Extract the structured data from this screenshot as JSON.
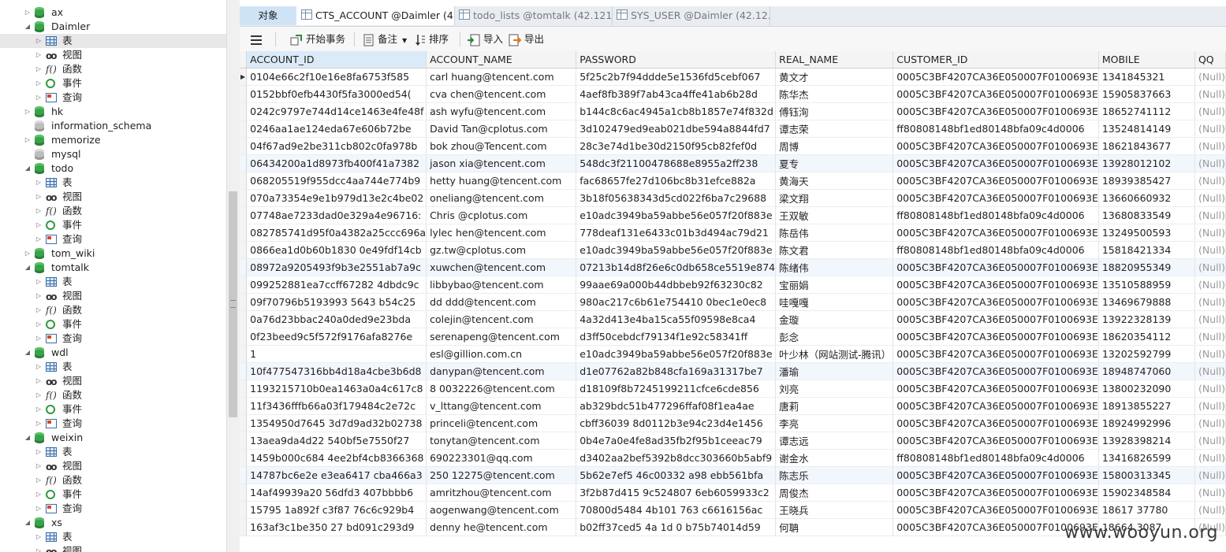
{
  "tree": [
    {
      "label": "ax",
      "level": 0,
      "type": "db",
      "expanded": false
    },
    {
      "label": "Daimler",
      "level": 0,
      "type": "db",
      "expanded": true
    },
    {
      "label": "表",
      "level": 1,
      "type": "table",
      "selected": true
    },
    {
      "label": "视图",
      "level": 1,
      "type": "view"
    },
    {
      "label": "函数",
      "level": 1,
      "type": "func"
    },
    {
      "label": "事件",
      "level": 1,
      "type": "event"
    },
    {
      "label": "查询",
      "level": 1,
      "type": "query"
    },
    {
      "label": "hk",
      "level": 0,
      "type": "db",
      "expanded": false
    },
    {
      "label": "information_schema",
      "level": 0,
      "type": "db-gray",
      "expanded": null
    },
    {
      "label": "memorize",
      "level": 0,
      "type": "db",
      "expanded": false
    },
    {
      "label": "mysql",
      "level": 0,
      "type": "db-gray",
      "expanded": null
    },
    {
      "label": "todo",
      "level": 0,
      "type": "db",
      "expanded": true
    },
    {
      "label": "表",
      "level": 1,
      "type": "table"
    },
    {
      "label": "视图",
      "level": 1,
      "type": "view"
    },
    {
      "label": "函数",
      "level": 1,
      "type": "func"
    },
    {
      "label": "事件",
      "level": 1,
      "type": "event"
    },
    {
      "label": "查询",
      "level": 1,
      "type": "query"
    },
    {
      "label": "tom_wiki",
      "level": 0,
      "type": "db",
      "expanded": false
    },
    {
      "label": "tomtalk",
      "level": 0,
      "type": "db",
      "expanded": true
    },
    {
      "label": "表",
      "level": 1,
      "type": "table"
    },
    {
      "label": "视图",
      "level": 1,
      "type": "view"
    },
    {
      "label": "函数",
      "level": 1,
      "type": "func"
    },
    {
      "label": "事件",
      "level": 1,
      "type": "event"
    },
    {
      "label": "查询",
      "level": 1,
      "type": "query"
    },
    {
      "label": "wdl",
      "level": 0,
      "type": "db",
      "expanded": true
    },
    {
      "label": "表",
      "level": 1,
      "type": "table"
    },
    {
      "label": "视图",
      "level": 1,
      "type": "view"
    },
    {
      "label": "函数",
      "level": 1,
      "type": "func"
    },
    {
      "label": "事件",
      "level": 1,
      "type": "event"
    },
    {
      "label": "查询",
      "level": 1,
      "type": "query"
    },
    {
      "label": "weixin",
      "level": 0,
      "type": "db",
      "expanded": true
    },
    {
      "label": "表",
      "level": 1,
      "type": "table"
    },
    {
      "label": "视图",
      "level": 1,
      "type": "view"
    },
    {
      "label": "函数",
      "level": 1,
      "type": "func"
    },
    {
      "label": "事件",
      "level": 1,
      "type": "event"
    },
    {
      "label": "查询",
      "level": 1,
      "type": "query"
    },
    {
      "label": "xs",
      "level": 0,
      "type": "db",
      "expanded": true
    },
    {
      "label": "表",
      "level": 1,
      "type": "table"
    },
    {
      "label": "视图",
      "level": 1,
      "type": "view"
    }
  ],
  "tabs": [
    {
      "label": "对象",
      "icon": "none",
      "state": "first"
    },
    {
      "label": "CTS_ACCOUNT @Daimler (4...",
      "icon": "table-icon",
      "state": "active"
    },
    {
      "label": "todo_lists @tomtalk (42.121...",
      "icon": "table-icon",
      "state": "dim"
    },
    {
      "label": "SYS_USER @Daimler (42.12...",
      "icon": "table-icon",
      "state": "dim"
    }
  ],
  "toolbar": {
    "begin_tx": "开始事务",
    "memo": "备注",
    "sort": "排序",
    "import": "导入",
    "export": "导出"
  },
  "grid": {
    "columns": [
      "ACCOUNT_ID",
      "ACCOUNT_NAME",
      "PASSWORD",
      "REAL_NAME",
      "CUSTOMER_ID",
      "MOBILE",
      "QQ"
    ],
    "rows": [
      [
        "0104e66c2f10e16e8fa6753f585",
        "carl huang@tencent.com",
        "5f25c2b7f94ddde5e1536fd5cebf067",
        "黄文才",
        "0005C3BF4207CA36E050007F0100693E",
        "1341845321",
        "(Null)"
      ],
      [
        "0152bbf0efb4430f5fa3000ed54(",
        "cva chen@tencent.com",
        "4aef8fb389f7ab43ca4ffe41ab6b28d",
        "陈华杰",
        "0005C3BF4207CA36E050007F0100693E",
        "15905837663",
        "(Null)"
      ],
      [
        "0242c9797e744d14ce1463e4fe48f",
        "ash wyfu@tencent.com",
        "b144c8c6ac4945a1cb8b1857e74f832d",
        "傅钰洵",
        "0005C3BF4207CA36E050007F0100693E",
        "18652741112",
        "(Null)"
      ],
      [
        "0246aa1ae124eda67e606b72be",
        "David Tan@cplotus.com",
        "3d102479ed9eab021dbe594a8844fd7",
        "谭志荣",
        "ff80808148bf1ed80148bfa09c4d0006",
        "13524814149",
        "(Null)"
      ],
      [
        "04f67ad9e2be311cb802c0fa978b",
        "bok zhou@Tencent.com",
        "28c3e74d1be30d2150f95cb82fef0d",
        "周博",
        "0005C3BF4207CA36E050007F0100693E",
        "18621843677",
        "(Null)"
      ],
      [
        "06434200a1d8973fb400f41a7382",
        "jason xia@tencent.com",
        "548dc3f21100478688e8955a2ff238",
        "夏专",
        "0005C3BF4207CA36E050007F0100693E",
        "13928012102",
        "(Null)"
      ],
      [
        "068205519f955dcc4aa744e774b9",
        "hetty huang@tencent.com",
        "fac68657fe27d106bc8b31efce882a",
        "黄海天",
        "0005C3BF4207CA36E050007F0100693E",
        "18939385427",
        "(Null)"
      ],
      [
        "070a73354e9e1b979d13e2c4be02",
        "oneliang@tencent.com",
        "3b18f05638343d5cd022f6ba7c29688",
        "梁文翔",
        "0005C3BF4207CA36E050007F0100693E",
        "13660660932",
        "(Null)"
      ],
      [
        "07748ae7233dad0e329a4e96716:",
        "Chris @cplotus.com",
        "e10adc3949ba59abbe56e057f20f883e",
        "王双敏",
        "ff80808148bf1ed80148bfa09c4d0006",
        "13680833549",
        "(Null)"
      ],
      [
        "082785741d95f0a4382a25ccc696a",
        "lylec hen@tencent.com",
        "778deaf131e6433c01b3d494ac79d21",
        "陈岳伟",
        "0005C3BF4207CA36E050007F0100693E",
        "13249500593",
        "(Null)"
      ],
      [
        "0866ea1d0b60b1830 0e49fdf14cb",
        "gz.tw@cplotus.com",
        "e10adc3949ba59abbe56e057f20f883e",
        "陈文君",
        "ff80808148bf1ed80148bfa09c4d0006",
        "15818421334",
        "(Null)"
      ],
      [
        "08972a9205493f9b3e2551ab7a9c",
        "xuwchen@tencent.com",
        "07213b14d8f26e6c0db658ce5519e874",
        "陈绪伟",
        "0005C3BF4207CA36E050007F0100693E",
        "18820955349",
        "(Null)"
      ],
      [
        "099252881ea7ccff67282 4dbdc9c",
        "libbybao@tencent.com",
        "99aae69a000b44dbbeb92f63230c82",
        "宝丽娟",
        "0005C3BF4207CA36E050007F0100693E",
        "13510588959",
        "(Null)"
      ],
      [
        "09f70796b5193993 5643 b54c25",
        "dd ddd@tencent.com",
        "980ac217c6b61e754410 0bec1e0ec8",
        "哇嘎嘎",
        "0005C3BF4207CA36E050007F0100693E",
        "13469679888",
        "(Null)"
      ],
      [
        "0a76d23bbac240a0ded9e23bda",
        "colejin@tencent.com",
        "4a32d413e4ba15ca55f09598e8ca4",
        "金璇",
        "0005C3BF4207CA36E050007F0100693E",
        "13922328139",
        "(Null)"
      ],
      [
        "0f23beed9c5f572f9176afa8276e",
        "serenapeng@tencent.com",
        "d3ff50cebdcf79134f1e92c58341ff",
        "彭念",
        "0005C3BF4207CA36E050007F0100693E",
        "18620354112",
        "(Null)"
      ],
      [
        "1",
        "esl@gillion.com.cn",
        "e10adc3949ba59abbe56e057f20f883e",
        "叶少林（网站测试-腾讯）",
        "0005C3BF4207CA36E050007F0100693E",
        "13202592799",
        "(Null)"
      ],
      [
        "10f477547316bb4d18a4cbe3b6d8",
        "danypan@tencent.com",
        "d1e07762a82b848cfa169a31317be7",
        "潘瑜",
        "0005C3BF4207CA36E050007F0100693E",
        "18948747060",
        "(Null)"
      ],
      [
        "1193215710b0ea1463a0a4c617c8",
        "8 0032226@tencent.com",
        "d18109f8b7245199211cfce6cde856",
        "刘亮",
        "0005C3BF4207CA36E050007F0100693E",
        "13800232090",
        "(Null)"
      ],
      [
        "11f3436fffb66a03f179484c2e72c",
        "v_lttang@tencent.com",
        "ab329bdc51b477296ffaf08f1ea4ae",
        "唐莉",
        "0005C3BF4207CA36E050007F0100693E",
        "18913855227",
        "(Null)"
      ],
      [
        "1354950d7645 3d7d9ad32b02738",
        "princeli@tencent.com",
        "cbff36039 8d0112b3e94c23d4e1456",
        "李亮",
        "0005C3BF4207CA36E050007F0100693E",
        "18924992996",
        "(Null)"
      ],
      [
        "13aea9da4d22 540bf5e7550f27",
        "tonytan@tencent.com",
        "0b4e7a0e4fe8ad35fb2f95b1ceeac79",
        "谭志远",
        "0005C3BF4207CA36E050007F0100693E",
        "13928398214",
        "(Null)"
      ],
      [
        "1459b000c684 4ee2bf4cb8366368",
        "690223301@qq.com",
        "d3402aa2bef5392b8dcc303660b5abf9",
        "谢金水",
        "ff80808148bf1ed80148bfa09c4d0006",
        "13416826599",
        "(Null)"
      ],
      [
        "14787bc6e2e e3ea6417 cba466a3",
        "250 12275@tencent.com",
        "5b62e7ef5 46c00332 a98 ebb561bfa",
        "陈志乐",
        "0005C3BF4207CA36E050007F0100693E",
        "15800313345",
        "(Null)"
      ],
      [
        "14af49939a20 56dfd3 407bbbb6",
        "amritzhou@tencent.com",
        "3f2b87d415 9c524807 6eb6059933c2",
        "周俊杰",
        "0005C3BF4207CA36E050007F0100693E",
        "15902348584",
        "(Null)"
      ],
      [
        "15795 1a892f c3f87 76c6c929b4",
        "aogenwang@tencent.com",
        "70800d5484 4b101 763 c6616156ac",
        "王晓兵",
        "0005C3BF4207CA36E050007F0100693E",
        "18617 37780",
        "(Null)"
      ],
      [
        "163af3c1be350 27 bd091c293d9",
        "denny he@tencent.com",
        "b02ff37ced5 4a 1d 0 b75b74014d59",
        "何聃",
        "0005C3BF4207CA36E050007F0100693E",
        "18664 3087",
        "(Null)"
      ]
    ]
  },
  "watermark": "www.wooyun.org"
}
